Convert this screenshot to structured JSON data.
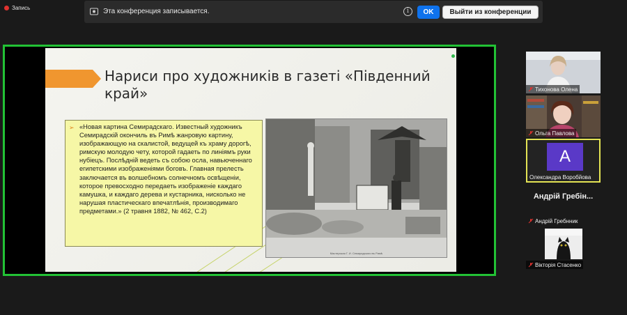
{
  "recording": {
    "label": "Запись"
  },
  "banner": {
    "text": "Эта конференция записывается.",
    "ok_label": "OK",
    "leave_label": "Выйти из конференции"
  },
  "slide": {
    "title": "Нариси про художників в газеті «Південний край»",
    "quote": "«Новая картина Семирадскаго. Известный художникъ Семирадскій окончиль въ Римѣ жанровую картину, изображающую на скалистой, ведущей къ храму дорогѣ, римскую молодую чету, которой гадаеть по линіямъ руки нубіецъ. Послѣдній ведеть съ собою осла, навьюченнаго египетскими изображеніями боговъ. Главная прелесть заключается въ волшебномъ солнечномъ освѣщеніи, которое превосходно передаеть изображеніе каждаго камушка, и каждаго дерева и кустарника, нисколько не нарушая пластическаго впечатлѣнія, производимаго предметами.» (2 травня 1882, № 462, С.2)",
    "photo_caption": "Мастерская Г. И. Семирадскаго въ Римѣ"
  },
  "participants": [
    {
      "name": "Тихонова Олена",
      "muted": true
    },
    {
      "name": "Ольга Павлова",
      "muted": true
    },
    {
      "name": "Олександра Воробйова",
      "initial": "A",
      "active": true
    },
    {
      "name": "Андрій Гребнник",
      "display_name": "Андрій Гребін...",
      "muted": true
    },
    {
      "name": "Вікторія Стасенко",
      "muted": true
    }
  ],
  "colors": {
    "share_border": "#22c235",
    "ok_button": "#0e72ed",
    "avatar_bg": "#5a39c7",
    "active_speaker": "#e4e454"
  }
}
